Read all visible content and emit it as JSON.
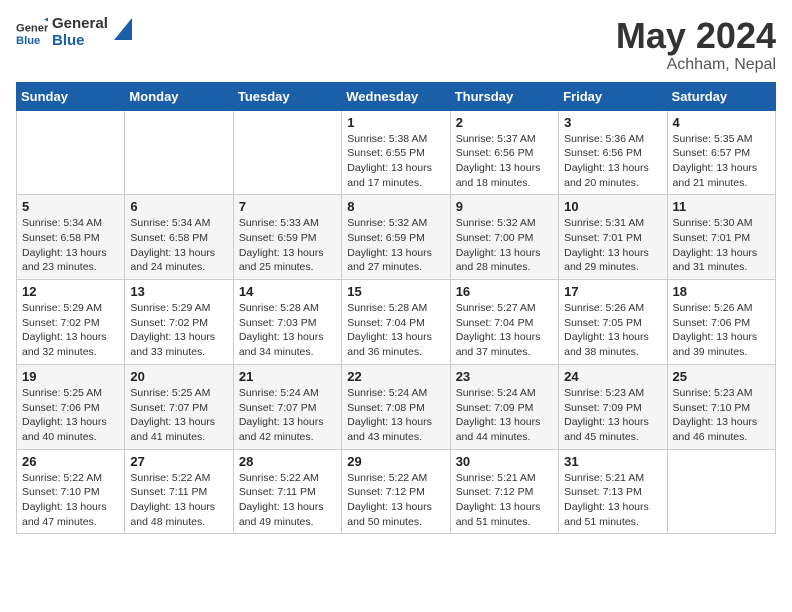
{
  "header": {
    "logo_general": "General",
    "logo_blue": "Blue",
    "month": "May 2024",
    "location": "Achham, Nepal"
  },
  "weekdays": [
    "Sunday",
    "Monday",
    "Tuesday",
    "Wednesday",
    "Thursday",
    "Friday",
    "Saturday"
  ],
  "weeks": [
    [
      {
        "day": "",
        "sunrise": "",
        "sunset": "",
        "daylight": ""
      },
      {
        "day": "",
        "sunrise": "",
        "sunset": "",
        "daylight": ""
      },
      {
        "day": "",
        "sunrise": "",
        "sunset": "",
        "daylight": ""
      },
      {
        "day": "1",
        "sunrise": "Sunrise: 5:38 AM",
        "sunset": "Sunset: 6:55 PM",
        "daylight": "Daylight: 13 hours and 17 minutes."
      },
      {
        "day": "2",
        "sunrise": "Sunrise: 5:37 AM",
        "sunset": "Sunset: 6:56 PM",
        "daylight": "Daylight: 13 hours and 18 minutes."
      },
      {
        "day": "3",
        "sunrise": "Sunrise: 5:36 AM",
        "sunset": "Sunset: 6:56 PM",
        "daylight": "Daylight: 13 hours and 20 minutes."
      },
      {
        "day": "4",
        "sunrise": "Sunrise: 5:35 AM",
        "sunset": "Sunset: 6:57 PM",
        "daylight": "Daylight: 13 hours and 21 minutes."
      }
    ],
    [
      {
        "day": "5",
        "sunrise": "Sunrise: 5:34 AM",
        "sunset": "Sunset: 6:58 PM",
        "daylight": "Daylight: 13 hours and 23 minutes."
      },
      {
        "day": "6",
        "sunrise": "Sunrise: 5:34 AM",
        "sunset": "Sunset: 6:58 PM",
        "daylight": "Daylight: 13 hours and 24 minutes."
      },
      {
        "day": "7",
        "sunrise": "Sunrise: 5:33 AM",
        "sunset": "Sunset: 6:59 PM",
        "daylight": "Daylight: 13 hours and 25 minutes."
      },
      {
        "day": "8",
        "sunrise": "Sunrise: 5:32 AM",
        "sunset": "Sunset: 6:59 PM",
        "daylight": "Daylight: 13 hours and 27 minutes."
      },
      {
        "day": "9",
        "sunrise": "Sunrise: 5:32 AM",
        "sunset": "Sunset: 7:00 PM",
        "daylight": "Daylight: 13 hours and 28 minutes."
      },
      {
        "day": "10",
        "sunrise": "Sunrise: 5:31 AM",
        "sunset": "Sunset: 7:01 PM",
        "daylight": "Daylight: 13 hours and 29 minutes."
      },
      {
        "day": "11",
        "sunrise": "Sunrise: 5:30 AM",
        "sunset": "Sunset: 7:01 PM",
        "daylight": "Daylight: 13 hours and 31 minutes."
      }
    ],
    [
      {
        "day": "12",
        "sunrise": "Sunrise: 5:29 AM",
        "sunset": "Sunset: 7:02 PM",
        "daylight": "Daylight: 13 hours and 32 minutes."
      },
      {
        "day": "13",
        "sunrise": "Sunrise: 5:29 AM",
        "sunset": "Sunset: 7:02 PM",
        "daylight": "Daylight: 13 hours and 33 minutes."
      },
      {
        "day": "14",
        "sunrise": "Sunrise: 5:28 AM",
        "sunset": "Sunset: 7:03 PM",
        "daylight": "Daylight: 13 hours and 34 minutes."
      },
      {
        "day": "15",
        "sunrise": "Sunrise: 5:28 AM",
        "sunset": "Sunset: 7:04 PM",
        "daylight": "Daylight: 13 hours and 36 minutes."
      },
      {
        "day": "16",
        "sunrise": "Sunrise: 5:27 AM",
        "sunset": "Sunset: 7:04 PM",
        "daylight": "Daylight: 13 hours and 37 minutes."
      },
      {
        "day": "17",
        "sunrise": "Sunrise: 5:26 AM",
        "sunset": "Sunset: 7:05 PM",
        "daylight": "Daylight: 13 hours and 38 minutes."
      },
      {
        "day": "18",
        "sunrise": "Sunrise: 5:26 AM",
        "sunset": "Sunset: 7:06 PM",
        "daylight": "Daylight: 13 hours and 39 minutes."
      }
    ],
    [
      {
        "day": "19",
        "sunrise": "Sunrise: 5:25 AM",
        "sunset": "Sunset: 7:06 PM",
        "daylight": "Daylight: 13 hours and 40 minutes."
      },
      {
        "day": "20",
        "sunrise": "Sunrise: 5:25 AM",
        "sunset": "Sunset: 7:07 PM",
        "daylight": "Daylight: 13 hours and 41 minutes."
      },
      {
        "day": "21",
        "sunrise": "Sunrise: 5:24 AM",
        "sunset": "Sunset: 7:07 PM",
        "daylight": "Daylight: 13 hours and 42 minutes."
      },
      {
        "day": "22",
        "sunrise": "Sunrise: 5:24 AM",
        "sunset": "Sunset: 7:08 PM",
        "daylight": "Daylight: 13 hours and 43 minutes."
      },
      {
        "day": "23",
        "sunrise": "Sunrise: 5:24 AM",
        "sunset": "Sunset: 7:09 PM",
        "daylight": "Daylight: 13 hours and 44 minutes."
      },
      {
        "day": "24",
        "sunrise": "Sunrise: 5:23 AM",
        "sunset": "Sunset: 7:09 PM",
        "daylight": "Daylight: 13 hours and 45 minutes."
      },
      {
        "day": "25",
        "sunrise": "Sunrise: 5:23 AM",
        "sunset": "Sunset: 7:10 PM",
        "daylight": "Daylight: 13 hours and 46 minutes."
      }
    ],
    [
      {
        "day": "26",
        "sunrise": "Sunrise: 5:22 AM",
        "sunset": "Sunset: 7:10 PM",
        "daylight": "Daylight: 13 hours and 47 minutes."
      },
      {
        "day": "27",
        "sunrise": "Sunrise: 5:22 AM",
        "sunset": "Sunset: 7:11 PM",
        "daylight": "Daylight: 13 hours and 48 minutes."
      },
      {
        "day": "28",
        "sunrise": "Sunrise: 5:22 AM",
        "sunset": "Sunset: 7:11 PM",
        "daylight": "Daylight: 13 hours and 49 minutes."
      },
      {
        "day": "29",
        "sunrise": "Sunrise: 5:22 AM",
        "sunset": "Sunset: 7:12 PM",
        "daylight": "Daylight: 13 hours and 50 minutes."
      },
      {
        "day": "30",
        "sunrise": "Sunrise: 5:21 AM",
        "sunset": "Sunset: 7:12 PM",
        "daylight": "Daylight: 13 hours and 51 minutes."
      },
      {
        "day": "31",
        "sunrise": "Sunrise: 5:21 AM",
        "sunset": "Sunset: 7:13 PM",
        "daylight": "Daylight: 13 hours and 51 minutes."
      },
      {
        "day": "",
        "sunrise": "",
        "sunset": "",
        "daylight": ""
      }
    ]
  ]
}
